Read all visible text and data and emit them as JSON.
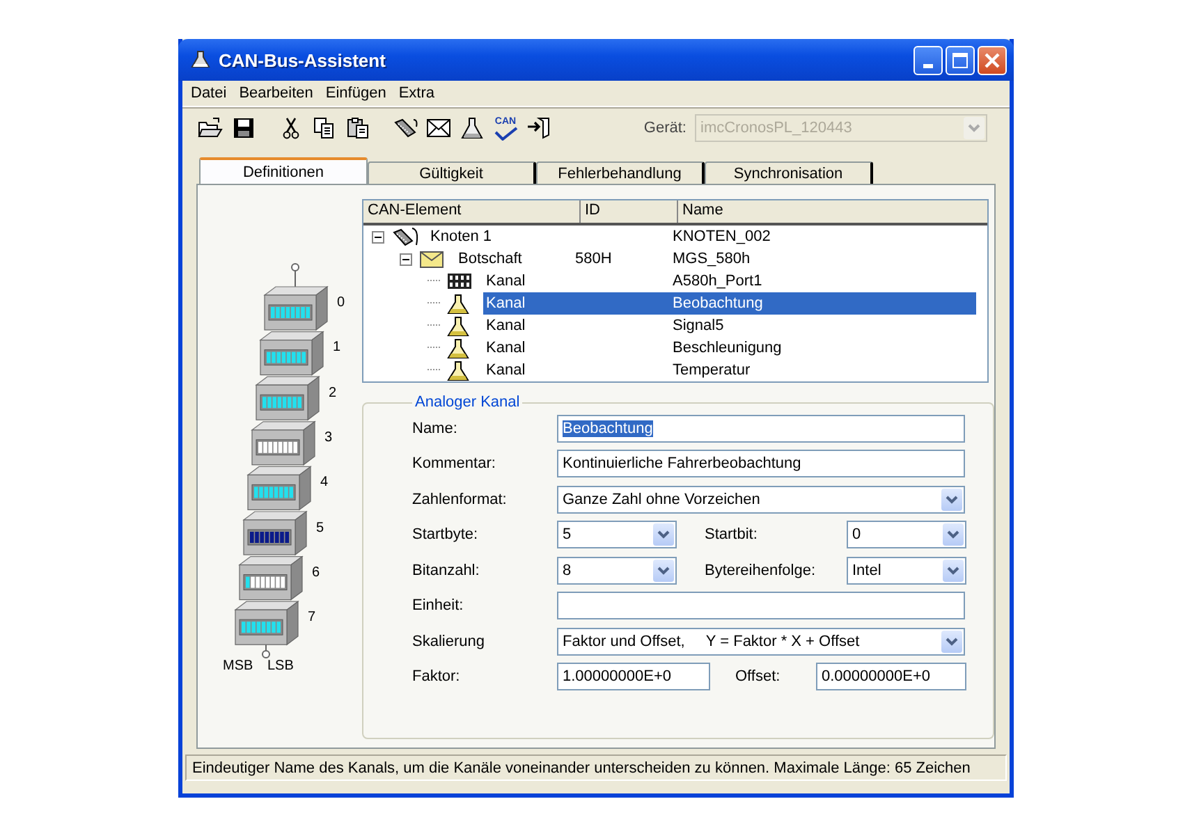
{
  "window": {
    "title": "CAN-Bus-Assistent"
  },
  "menu": [
    "Datei",
    "Bearbeiten",
    "Einfügen",
    "Extra"
  ],
  "toolbar": {
    "groups": [
      [
        {
          "kind": "open"
        },
        {
          "kind": "save"
        }
      ],
      [
        {
          "kind": "cut"
        },
        {
          "kind": "copy"
        },
        {
          "kind": "paste"
        }
      ],
      [
        {
          "kind": "node"
        },
        {
          "kind": "message"
        },
        {
          "kind": "analog"
        },
        {
          "kind": "check",
          "label": "CAN"
        },
        {
          "kind": "exit"
        }
      ]
    ],
    "device_label": "Gerät:",
    "device": {
      "value": "imcCronosPL_120443",
      "disabled": true
    }
  },
  "tabs": [
    {
      "label": "Definitionen",
      "selected": true
    },
    {
      "label": "Gültigkeit",
      "selected": false
    },
    {
      "label": "Fehlerbehandlung",
      "selected": false
    },
    {
      "label": "Synchronisation",
      "selected": false
    }
  ],
  "bytes": {
    "items": [
      {
        "label": "0",
        "kind": "used"
      },
      {
        "label": "1",
        "kind": "used"
      },
      {
        "label": "2",
        "kind": "used"
      },
      {
        "label": "3",
        "kind": "free"
      },
      {
        "label": "4",
        "kind": "used"
      },
      {
        "label": "5",
        "kind": "selected"
      },
      {
        "label": "6",
        "kind": "partial"
      },
      {
        "label": "7",
        "kind": "used"
      }
    ],
    "msb": "MSB",
    "lsb": "LSB"
  },
  "tree": {
    "columns": [
      "CAN-Element",
      "ID",
      "Name"
    ],
    "items": [
      {
        "kind": "node",
        "element": "Knoten 1",
        "name": "KNOTEN_002",
        "expanded": true,
        "selected": false,
        "children": [
          {
            "kind": "message",
            "element": "Botschaft",
            "id": "580H",
            "name": "MGS_580h",
            "expanded": true,
            "selected": false,
            "children": [
              {
                "kind": "digital",
                "element": "Kanal",
                "name": "A580h_Port1",
                "selected": false
              },
              {
                "kind": "analog",
                "element": "Kanal",
                "name": "Beobachtung",
                "selected": true
              },
              {
                "kind": "analog",
                "element": "Kanal",
                "name": "Signal5",
                "selected": false
              },
              {
                "kind": "analog",
                "element": "Kanal",
                "name": "Beschleunigung",
                "selected": false
              },
              {
                "kind": "analog",
                "element": "Kanal",
                "name": "Temperatur",
                "selected": false
              }
            ]
          }
        ]
      }
    ]
  },
  "group": {
    "title": "Analoger Kanal",
    "rows": [
      {
        "fields": [
          {
            "label": "Name:",
            "kind": "text",
            "value": "Beobachtung",
            "value_selected": true
          }
        ]
      },
      {
        "fields": [
          {
            "label": "Kommentar:",
            "kind": "text",
            "value": "Kontinuierliche Fahrerbeobachtung",
            "value_selected": false
          }
        ]
      },
      {
        "fields": [
          {
            "label": "Zahlenformat:",
            "kind": "select",
            "value": "Ganze Zahl ohne Vorzeichen"
          }
        ]
      },
      {
        "fields": [
          {
            "label": "Startbyte:",
            "kind": "select",
            "value": "5"
          },
          {
            "label": "Startbit:",
            "kind": "select",
            "value": "0"
          }
        ]
      },
      {
        "fields": [
          {
            "label": "Bitanzahl:",
            "kind": "select",
            "value": "8"
          },
          {
            "label": "Bytereihenfolge:",
            "kind": "select",
            "value": "Intel"
          }
        ]
      },
      {
        "fields": [
          {
            "label": "Einheit:",
            "kind": "text"
          }
        ]
      },
      {
        "fields": [
          {
            "label": "Skalierung",
            "kind": "select",
            "value": "Faktor und Offset,     Y = Faktor * X + Offset"
          }
        ]
      },
      {
        "fields": [
          {
            "label": "Faktor:",
            "kind": "text",
            "value": "1.00000000E+0",
            "value_selected": false
          },
          {
            "label": "Offset:",
            "kind": "text",
            "value": "0.00000000E+0",
            "value_selected": false
          }
        ]
      }
    ]
  },
  "status_bar": "Eindeutiger Name des Kanals, um die Kanäle voneinander unterscheiden zu können. Maximale Länge: 65 Zeichen"
}
